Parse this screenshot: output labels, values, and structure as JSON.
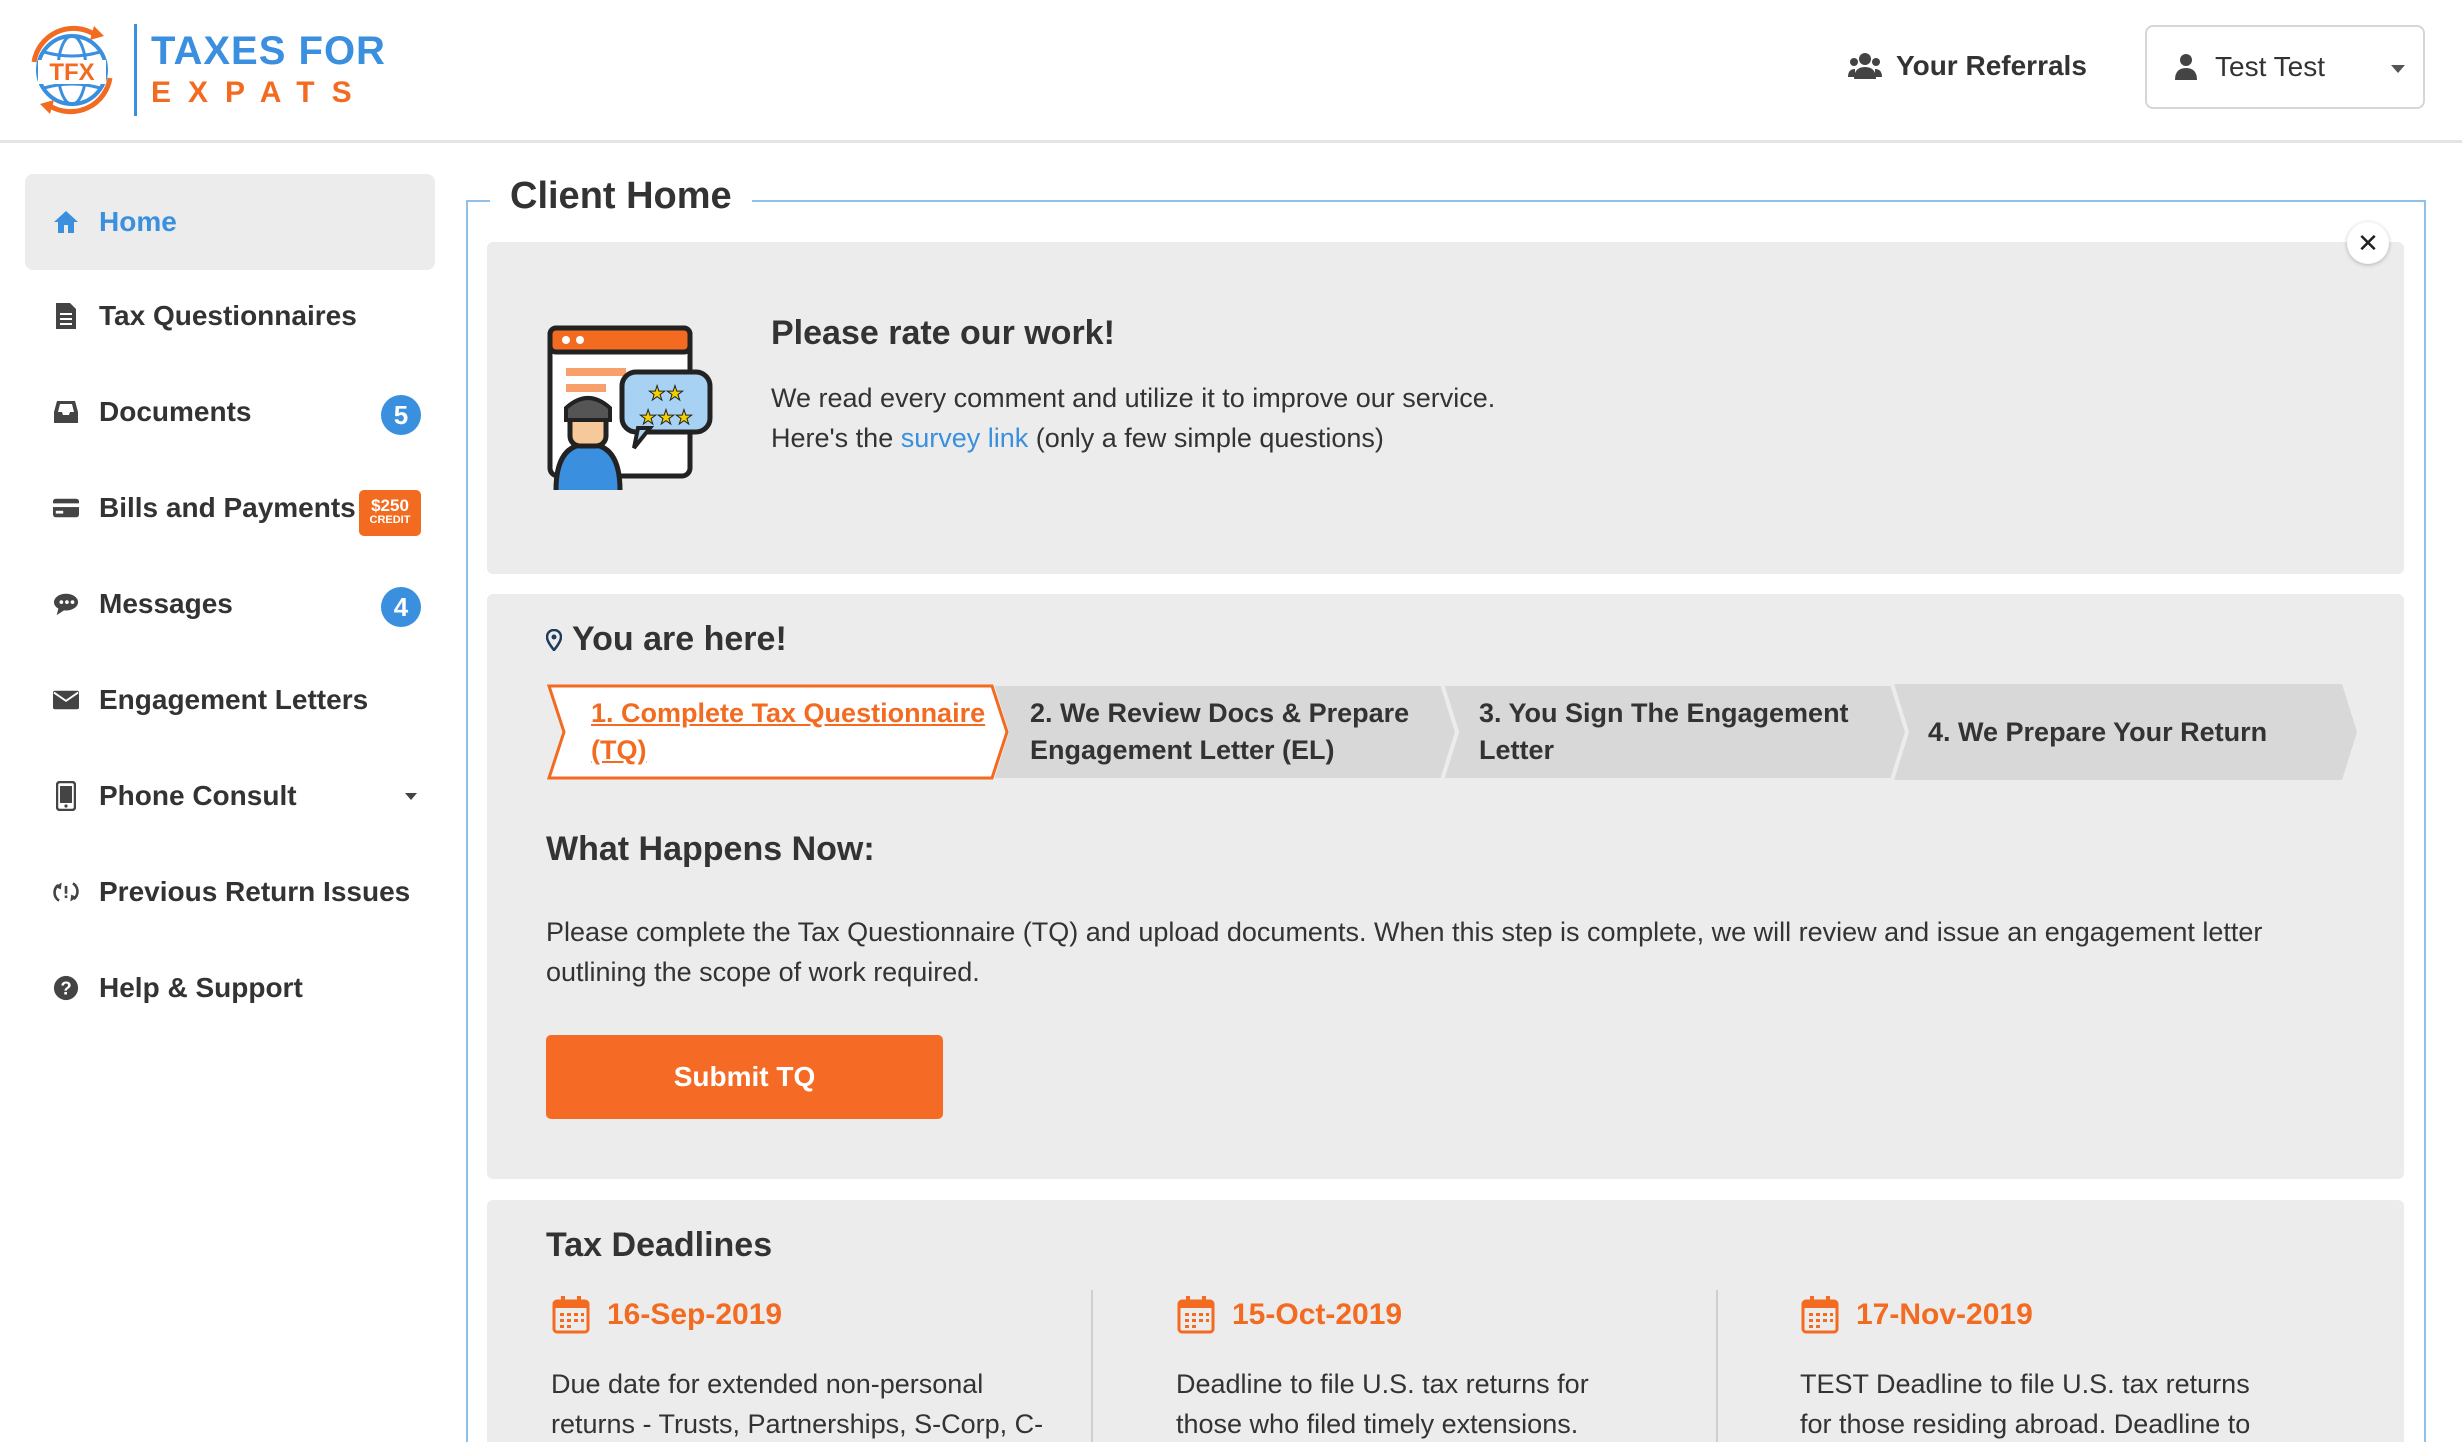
{
  "brand": {
    "line1": "TAXES FOR",
    "line2": "EXPATS",
    "monogram": "TFX",
    "blue": "#3a8fde",
    "orange": "#f36a21"
  },
  "header": {
    "referrals_label": "Your Referrals",
    "referrals_icon": "users-icon",
    "user_name": "Test Test",
    "user_icon": "user-icon"
  },
  "sidebar": {
    "items": [
      {
        "label": "Home",
        "icon": "home-icon",
        "active": true
      },
      {
        "label": "Tax Questionnaires",
        "icon": "document-list-icon"
      },
      {
        "label": "Documents",
        "icon": "inbox-icon",
        "badge": "5"
      },
      {
        "label": "Bills and Payments",
        "icon": "credit-card-icon",
        "credit_amount": "$250",
        "credit_label": "CREDIT"
      },
      {
        "label": "Messages",
        "icon": "chat-icon",
        "badge": "4"
      },
      {
        "label": "Engagement Letters",
        "icon": "envelope-icon"
      },
      {
        "label": "Phone Consult",
        "icon": "mobile-phone-icon"
      },
      {
        "label": "Previous Return Issues",
        "icon": "refresh-alert-icon"
      },
      {
        "label": "Help & Support",
        "icon": "question-circle-icon"
      }
    ]
  },
  "main": {
    "title": "Client Home",
    "rate": {
      "title": "Please rate our work!",
      "line1": "We read every comment and utilize it to improve our service.",
      "line2_prefix": "Here's the ",
      "line2_link": "survey link",
      "line2_suffix": " (only a few simple questions)"
    },
    "progress": {
      "title": "You are here!",
      "steps": [
        {
          "label_line1": "1. Complete Tax Questionnaire",
          "label_line2": "(TQ)",
          "active": true
        },
        {
          "label_line1": "2. We Review Docs & Prepare",
          "label_line2": "Engagement Letter (EL)"
        },
        {
          "label_line1": "3. You Sign The Engagement",
          "label_line2": "Letter"
        },
        {
          "label_line1": "4. We Prepare Your Return",
          "label_line2": ""
        }
      ]
    },
    "what_happens": {
      "title": "What Happens Now:",
      "text_line1": "Please complete the Tax Questionnaire (TQ) and upload documents. When this step is complete, we will review and issue an engagement letter",
      "text_line2": "outlining the scope of work required.",
      "button": "Submit TQ"
    },
    "deadlines": {
      "title": "Tax Deadlines",
      "items": [
        {
          "date": "16-Sep-2019",
          "line1": "Due date for extended non-personal",
          "line2": "returns - Trusts, Partnerships, S-Corp, C-"
        },
        {
          "date": "15-Oct-2019",
          "line1": "Deadline to file U.S. tax returns for",
          "line2": "those who filed timely extensions."
        },
        {
          "date": "17-Nov-2019",
          "line1": "TEST Deadline to file U.S. tax returns",
          "line2": "for those residing abroad. Deadline to"
        }
      ]
    }
  }
}
